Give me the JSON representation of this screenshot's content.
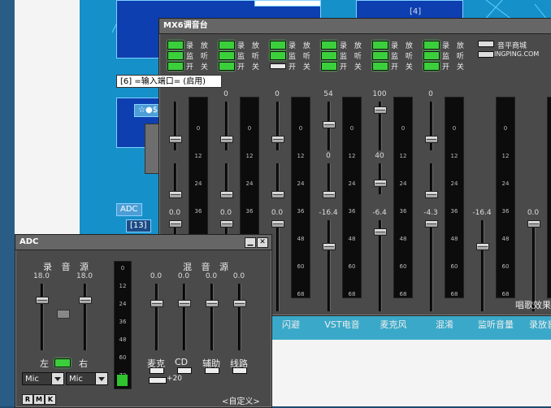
{
  "background": {
    "diagram_labels": [
      "[4]",
      "[13]",
      "[6]"
    ],
    "tooltip": "[6] =输入端口= (启用)",
    "adc_chip": "ADC",
    "node_chip": "[13]",
    "star_chip": "☆●$"
  },
  "mixer": {
    "title": "MX6调音台",
    "brand": {
      "line1": "音平商城",
      "line2": "INGPING.COM"
    },
    "toggle_labels": {
      "rec_play": "录 放",
      "monitor": "监 听",
      "on_off": "开 关"
    },
    "strips": [
      {
        "name": "",
        "top_value": "",
        "mid_value": "",
        "low_value": "0.0",
        "rec": true,
        "mon": true,
        "on": true
      },
      {
        "name": "",
        "top_value": "0",
        "mid_value": "",
        "low_value": "0.0",
        "rec": true,
        "mon": true,
        "on": true
      },
      {
        "name": "闪避",
        "top_value": "0",
        "mid_value": "",
        "low_value": "0.0",
        "rec": true,
        "mon": true,
        "on": false
      },
      {
        "name": "VST电音",
        "top_value": "54",
        "mid_value": "0",
        "low_value": "-16.4",
        "rec": true,
        "mon": true,
        "on": true
      },
      {
        "name": "麦克风",
        "top_value": "100",
        "mid_value": "40",
        "low_value": "-6.4",
        "rec": true,
        "mon": true,
        "on": true
      },
      {
        "name": "混淆",
        "top_value": "0",
        "mid_value": "",
        "low_value": "-4.3",
        "rec": true,
        "mon": true,
        "on": true
      },
      {
        "name": "监听音量",
        "top_value": "",
        "mid_value": "",
        "low_value": "-16.4",
        "rec": false,
        "mon": false,
        "on": false
      },
      {
        "name": "录放音量",
        "top_value": "",
        "mid_value": "",
        "low_value": "0.0",
        "rec": false,
        "mon": false,
        "on": false
      }
    ],
    "meter_ticks": [
      "0",
      "12",
      "24",
      "36",
      "48",
      "60",
      "68"
    ],
    "footer": "唱歌效果"
  },
  "adc": {
    "title": "ADC",
    "record_source": {
      "title": "录 音 源",
      "left_value": "18.0",
      "right_value": "18.0",
      "left_label": "左",
      "right_label": "右",
      "left_select": "Mic",
      "right_select": "Mic"
    },
    "meter_ticks": [
      "0",
      "12",
      "24",
      "36",
      "48",
      "60",
      "72"
    ],
    "mix_source": {
      "title": "混 音 源",
      "channels": [
        {
          "label": "麦克",
          "value": "0.0"
        },
        {
          "label": "CD",
          "value": "0.0"
        },
        {
          "label": "辅助",
          "value": "0.0"
        },
        {
          "label": "线路",
          "value": "0.0"
        }
      ],
      "boost": "+20"
    },
    "buttons": {
      "r": "R",
      "m": "M",
      "k": "K"
    },
    "custom": "<自定义>"
  }
}
